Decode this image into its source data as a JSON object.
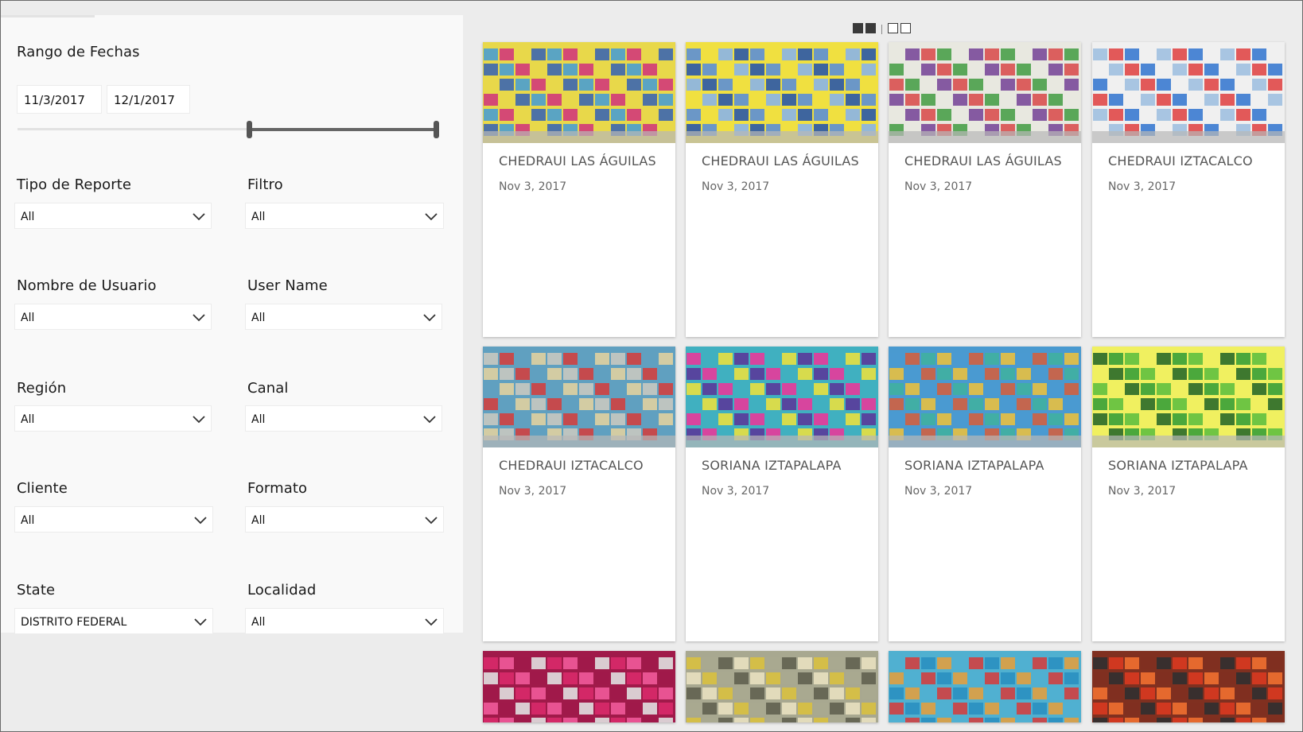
{
  "filters": {
    "date_range": {
      "label": "Rango de Fechas",
      "start": "11/3/2017",
      "end": "12/1/2017",
      "slider_start_fraction": 0.53,
      "slider_end_fraction": 1.0
    },
    "tipo_reporte": {
      "label": "Tipo de Reporte",
      "value": "All"
    },
    "filtro": {
      "label": "Filtro",
      "value": "All"
    },
    "nombre_usuario": {
      "label": "Nombre de Usuario",
      "value": "All"
    },
    "user_name": {
      "label": "User Name",
      "value": "All"
    },
    "region": {
      "label": "Región",
      "value": "All"
    },
    "canal": {
      "label": "Canal",
      "value": "All"
    },
    "cliente": {
      "label": "Cliente",
      "value": "All"
    },
    "formato": {
      "label": "Formato",
      "value": "All"
    },
    "state": {
      "label": "State",
      "value": "DISTRITO FEDERAL"
    },
    "localidad": {
      "label": "Localidad",
      "value": "All"
    }
  },
  "gallery": {
    "pager": {
      "pages": 4,
      "active_pages": [
        1,
        2
      ]
    },
    "cards": [
      {
        "store": "CHEDRAUI LAS ÁGUILAS",
        "date": "Nov 3, 2017",
        "image": "store-aisle-photo"
      },
      {
        "store": "CHEDRAUI LAS ÁGUILAS",
        "date": "Nov 3, 2017",
        "image": "store-aisle-photo"
      },
      {
        "store": "CHEDRAUI LAS ÁGUILAS",
        "date": "Nov 3, 2017",
        "image": "store-display-photo"
      },
      {
        "store": "CHEDRAUI IZTACALCO",
        "date": "Nov 3, 2017",
        "image": "store-display-photo"
      },
      {
        "store": "CHEDRAUI IZTACALCO",
        "date": "Nov 3, 2017",
        "image": "store-aisle-photo"
      },
      {
        "store": "SORIANA IZTAPALAPA",
        "date": "Nov 3, 2017",
        "image": "detergent-shelf-photo"
      },
      {
        "store": "SORIANA IZTAPALAPA",
        "date": "Nov 3, 2017",
        "image": "shelf-products-photo"
      },
      {
        "store": "SORIANA IZTAPALAPA",
        "date": "Nov 3, 2017",
        "image": "shelf-products-photo"
      },
      {
        "image": "product-shelf-photo"
      },
      {
        "image": "product-shelf-photo"
      },
      {
        "image": "product-shelf-photo"
      },
      {
        "image": "product-shelf-photo"
      }
    ]
  },
  "colors": {
    "panel_bg": "#f9f9f9",
    "page_bg": "#ececec",
    "slider": "#666666",
    "text": "#1a1a1a",
    "card_text": "#555555"
  }
}
